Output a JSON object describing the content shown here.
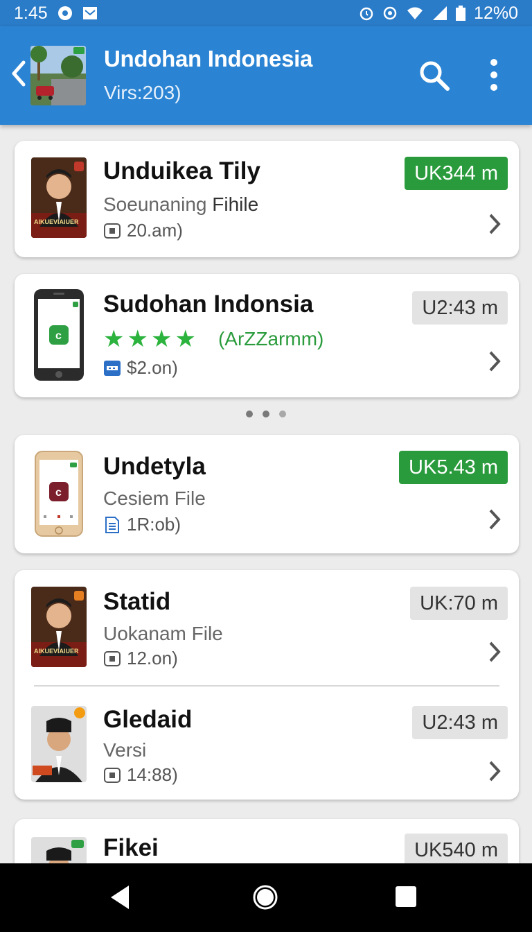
{
  "status_bar": {
    "time": "1:45",
    "battery": "12%0"
  },
  "app_bar": {
    "title": "Undohan Indonesia",
    "subtitle": "Virs:203)",
    "thumb_icon": "street-photo",
    "search_icon": "search-icon",
    "menu_icon": "more-vert-icon"
  },
  "cards": [
    {
      "items": [
        {
          "title": "Unduikea Tily",
          "subtitle_prefix": "Soeunaning ",
          "subtitle_strong": "Fihile",
          "meta": "20.am)",
          "badge": "UK344 m",
          "badge_style": "green",
          "thumb": "poster",
          "poster_caption": "AIKUEVIAIUER"
        }
      ]
    },
    {
      "items": [
        {
          "title": "Sudohan Indonsia",
          "rating_stars": 4,
          "rating_text": "(ArZZarmm)",
          "meta": "$2.on)",
          "badge": "U2:43 m",
          "badge_style": "gray",
          "thumb": "phone-black"
        }
      ]
    },
    {
      "items": [
        {
          "title": "Undetyla",
          "subtitle_prefix": "Cesiem File",
          "subtitle_strong": "",
          "meta": "1R:ob)",
          "badge": "UK5.43 m",
          "badge_style": "green",
          "thumb": "phone-gold"
        }
      ]
    },
    {
      "items": [
        {
          "title": "Statid",
          "subtitle_prefix": "Uokanam File",
          "subtitle_strong": "",
          "meta": "12.on)",
          "badge": "UK:70 m",
          "badge_style": "gray",
          "thumb": "poster",
          "poster_caption": "AIKUEVIAIUER"
        },
        {
          "title": "Gledaid",
          "subtitle_prefix": "Versi",
          "subtitle_strong": "",
          "meta": "14:88)",
          "badge": "U2:43 m",
          "badge_style": "gray",
          "thumb": "portrait"
        }
      ]
    },
    {
      "items": [
        {
          "title": "Fikei",
          "badge": "UK540 m",
          "badge_style": "gray",
          "thumb": "portrait-small"
        }
      ]
    }
  ],
  "colors": {
    "app_bar": "#2b84d3",
    "status_bar": "#2a7bc8",
    "badge_green": "#2a9b3c",
    "star": "#2bb33d"
  }
}
